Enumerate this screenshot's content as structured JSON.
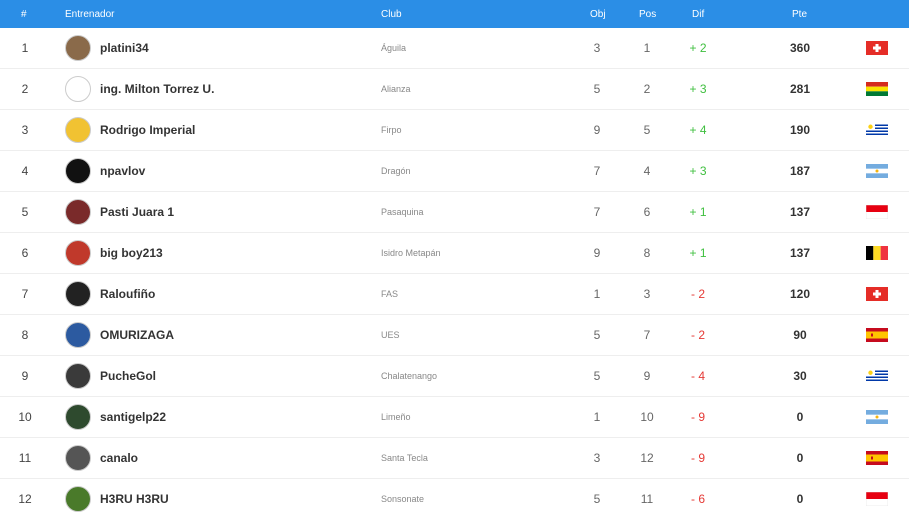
{
  "header": {
    "rank": "#",
    "coach": "Entrenador",
    "club": "Club",
    "obj": "Obj",
    "pos": "Pos",
    "dif": "Dif",
    "pts": "Pte"
  },
  "colors": {
    "header_bg": "#2b8ee6",
    "positive": "#3fbf3f",
    "negative": "#e53935"
  },
  "rows": [
    {
      "rank": "1",
      "name": "platini34",
      "club": "Águila",
      "obj": "3",
      "pos": "1",
      "dif": "+ 2",
      "dif_sign": "pos",
      "pts": "360",
      "flag": "switzerland-flag-icon",
      "avatar": "avatar-icon"
    },
    {
      "rank": "2",
      "name": "ing. Milton Torrez U.",
      "club": "Alianza",
      "obj": "5",
      "pos": "2",
      "dif": "+ 3",
      "dif_sign": "pos",
      "pts": "281",
      "flag": "bolivia-flag-icon",
      "avatar": "avatar-icon"
    },
    {
      "rank": "3",
      "name": "Rodrigo Imperial",
      "club": "Firpo",
      "obj": "9",
      "pos": "5",
      "dif": "+ 4",
      "dif_sign": "pos",
      "pts": "190",
      "flag": "uruguay-flag-icon",
      "avatar": "avatar-icon"
    },
    {
      "rank": "4",
      "name": "npavlov",
      "club": "Dragón",
      "obj": "7",
      "pos": "4",
      "dif": "+ 3",
      "dif_sign": "pos",
      "pts": "187",
      "flag": "argentina-flag-icon",
      "avatar": "avatar-icon"
    },
    {
      "rank": "5",
      "name": "Pasti Juara 1",
      "club": "Pasaquina",
      "obj": "7",
      "pos": "6",
      "dif": "+ 1",
      "dif_sign": "pos",
      "pts": "137",
      "flag": "indonesia-flag-icon",
      "avatar": "avatar-icon"
    },
    {
      "rank": "6",
      "name": "big boy213",
      "club": "Isidro Metapán",
      "obj": "9",
      "pos": "8",
      "dif": "+ 1",
      "dif_sign": "pos",
      "pts": "137",
      "flag": "belgium-flag-icon",
      "avatar": "avatar-icon"
    },
    {
      "rank": "7",
      "name": "Raloufiño",
      "club": "FAS",
      "obj": "1",
      "pos": "3",
      "dif": "- 2",
      "dif_sign": "neg",
      "pts": "120",
      "flag": "switzerland-flag-icon",
      "avatar": "avatar-icon"
    },
    {
      "rank": "8",
      "name": "OMURIZAGA",
      "club": "UES",
      "obj": "5",
      "pos": "7",
      "dif": "- 2",
      "dif_sign": "neg",
      "pts": "90",
      "flag": "spain-flag-icon",
      "avatar": "avatar-icon"
    },
    {
      "rank": "9",
      "name": "PucheGol",
      "club": "Chalatenango",
      "obj": "5",
      "pos": "9",
      "dif": "- 4",
      "dif_sign": "neg",
      "pts": "30",
      "flag": "uruguay-flag-icon",
      "avatar": "avatar-icon"
    },
    {
      "rank": "10",
      "name": "santigelp22",
      "club": "Limeño",
      "obj": "1",
      "pos": "10",
      "dif": "- 9",
      "dif_sign": "neg",
      "pts": "0",
      "flag": "argentina-flag-icon",
      "avatar": "avatar-icon"
    },
    {
      "rank": "11",
      "name": "canalo",
      "club": "Santa Tecla",
      "obj": "3",
      "pos": "12",
      "dif": "- 9",
      "dif_sign": "neg",
      "pts": "0",
      "flag": "spain-flag-icon",
      "avatar": "avatar-icon"
    },
    {
      "rank": "12",
      "name": "H3RU H3RU",
      "club": "Sonsonate",
      "obj": "5",
      "pos": "11",
      "dif": "- 6",
      "dif_sign": "neg",
      "pts": "0",
      "flag": "indonesia-flag-icon",
      "avatar": "avatar-icon"
    }
  ]
}
